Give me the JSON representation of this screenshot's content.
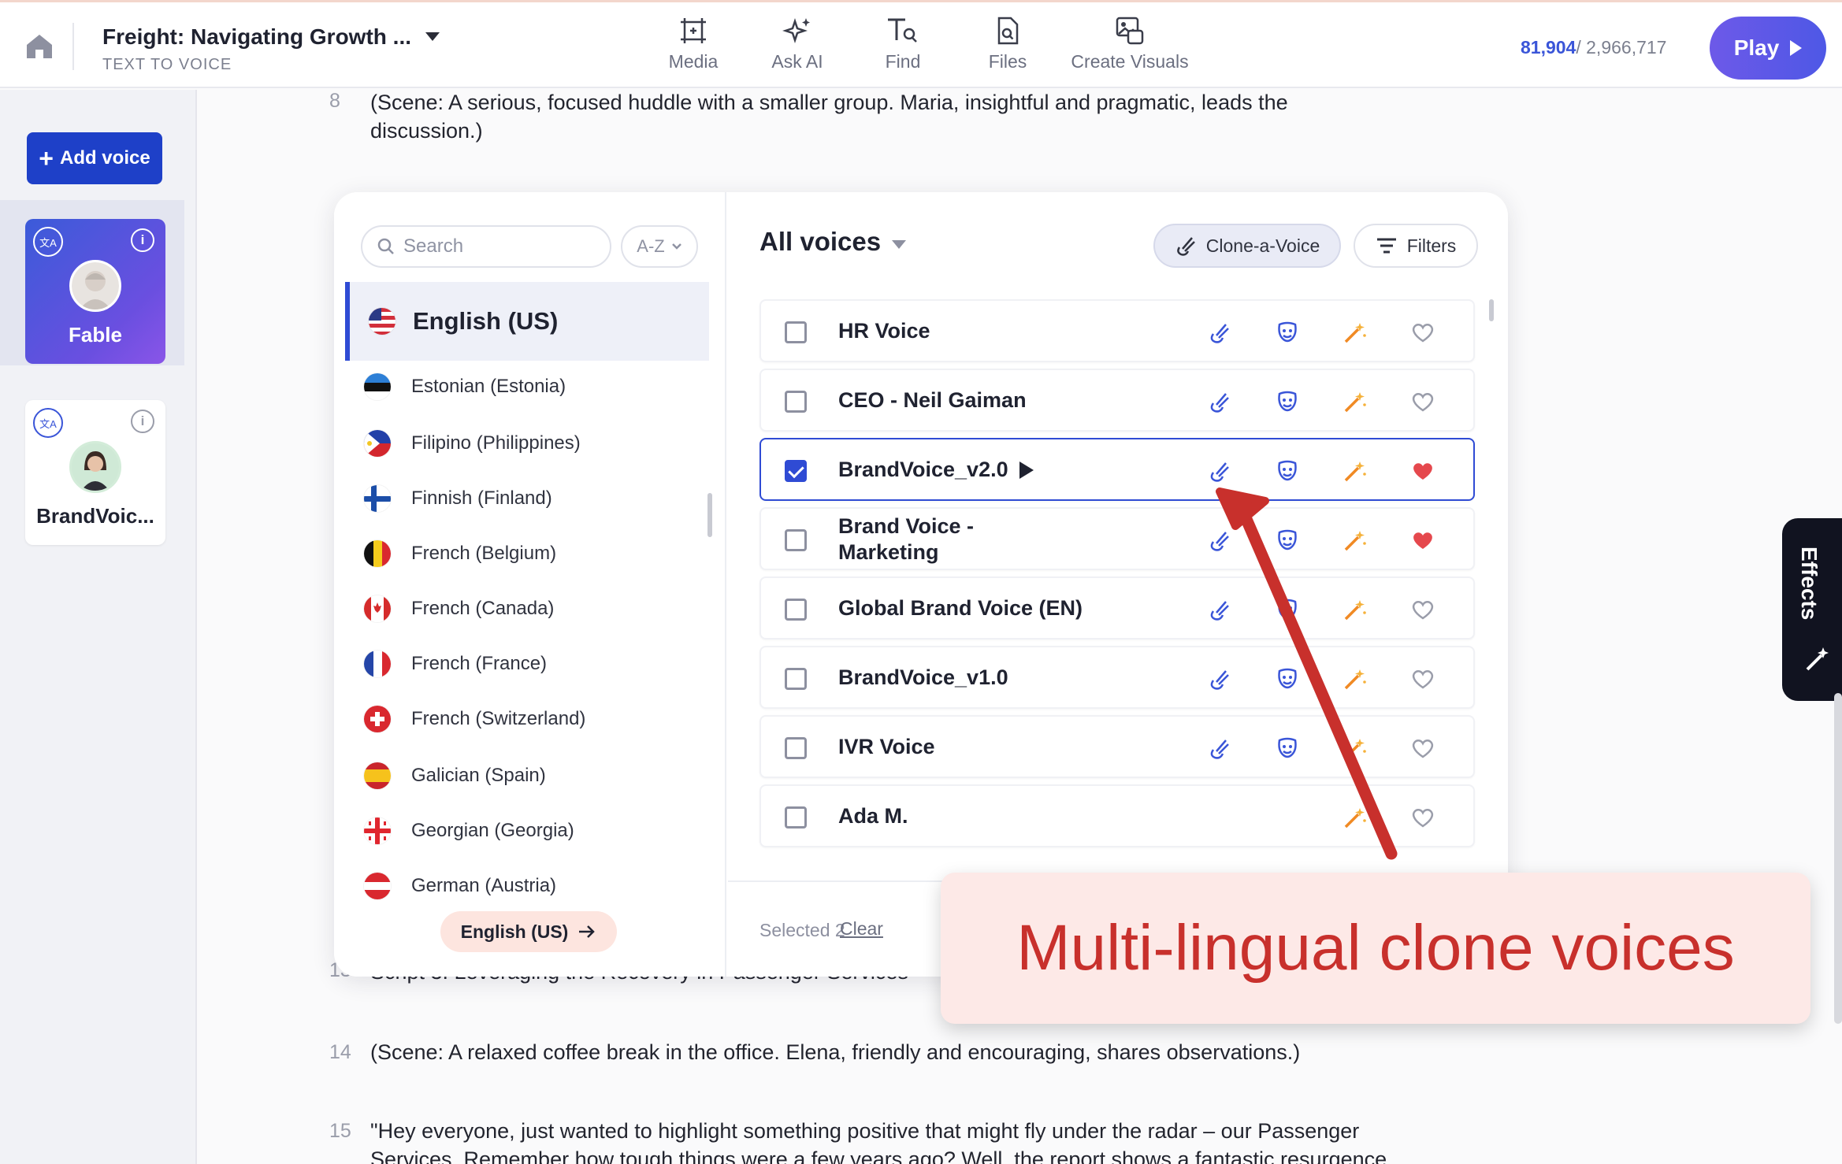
{
  "header": {
    "doc_title": "Freight: Navigating Growth ...",
    "doc_subtitle": "TEXT TO VOICE",
    "tools": [
      {
        "label": "Media",
        "icon": "media-icon"
      },
      {
        "label": "Ask AI",
        "icon": "sparkle-icon"
      },
      {
        "label": "Find",
        "icon": "find-icon"
      },
      {
        "label": "Files",
        "icon": "files-icon"
      },
      {
        "label": "Create Visuals",
        "icon": "visuals-icon"
      }
    ],
    "count_used": "81,904",
    "count_total": "/ 2,966,717",
    "play_label": "Play"
  },
  "sidebar": {
    "add_voice_label": "Add voice",
    "voices": [
      {
        "name": "Fable"
      },
      {
        "name": "BrandVoic..."
      }
    ]
  },
  "editor": {
    "lines": [
      {
        "num": "8",
        "text": "(Scene: A serious, focused huddle with a smaller group. Maria, insightful and pragmatic, leads the",
        "text2": "discussion.)"
      },
      {
        "num": "13",
        "text": "Script 3: Leveraging the Recovery in Passenger Services"
      },
      {
        "num": "14",
        "text": "(Scene: A relaxed coffee break in the office. Elena, friendly and encouraging, shares observations.)"
      },
      {
        "num": "15",
        "text": "\"Hey everyone, just wanted to highlight something positive that might fly under the radar – our Passenger",
        "text2": "Services. Remember how tough things were a few years ago? Well, the report shows a fantastic resurgence"
      }
    ]
  },
  "voice_panel": {
    "search_placeholder": "Search",
    "sort_label": "A-Z",
    "selected_language": "English (US)",
    "languages": [
      "Estonian (Estonia)",
      "Filipino (Philippines)",
      "Finnish (Finland)",
      "French (Belgium)",
      "French (Canada)",
      "French (France)",
      "French (Switzerland)",
      "Galician (Spain)",
      "Georgian (Georgia)",
      "German (Austria)"
    ],
    "language_chip": "English (US)",
    "all_voices_label": "All voices",
    "clone_label": "Clone-a-Voice",
    "filters_label": "Filters",
    "voices": [
      {
        "name": "HR Voice",
        "checked": false,
        "favorite": false
      },
      {
        "name": "CEO - Neil Gaiman",
        "checked": false,
        "favorite": false
      },
      {
        "name": "BrandVoice_v2.0",
        "checked": true,
        "favorite": true
      },
      {
        "name": "Brand Voice -",
        "name2": "Marketing",
        "checked": false,
        "favorite": true
      },
      {
        "name": "Global Brand Voice (EN)",
        "checked": false,
        "favorite": false
      },
      {
        "name": "BrandVoice_v1.0",
        "checked": false,
        "favorite": false
      },
      {
        "name": "IVR Voice",
        "checked": false,
        "favorite": false
      },
      {
        "name": "Ada M.",
        "checked": false,
        "favorite": false
      }
    ],
    "selected_text": "Selected 2",
    "clear_label": "Clear"
  },
  "effects_label": "Effects",
  "callout_text": "Multi-lingual clone voices",
  "colors": {
    "accent": "#2f4bd4",
    "callout_red": "#c8302c",
    "heart_red": "#e5484d"
  }
}
